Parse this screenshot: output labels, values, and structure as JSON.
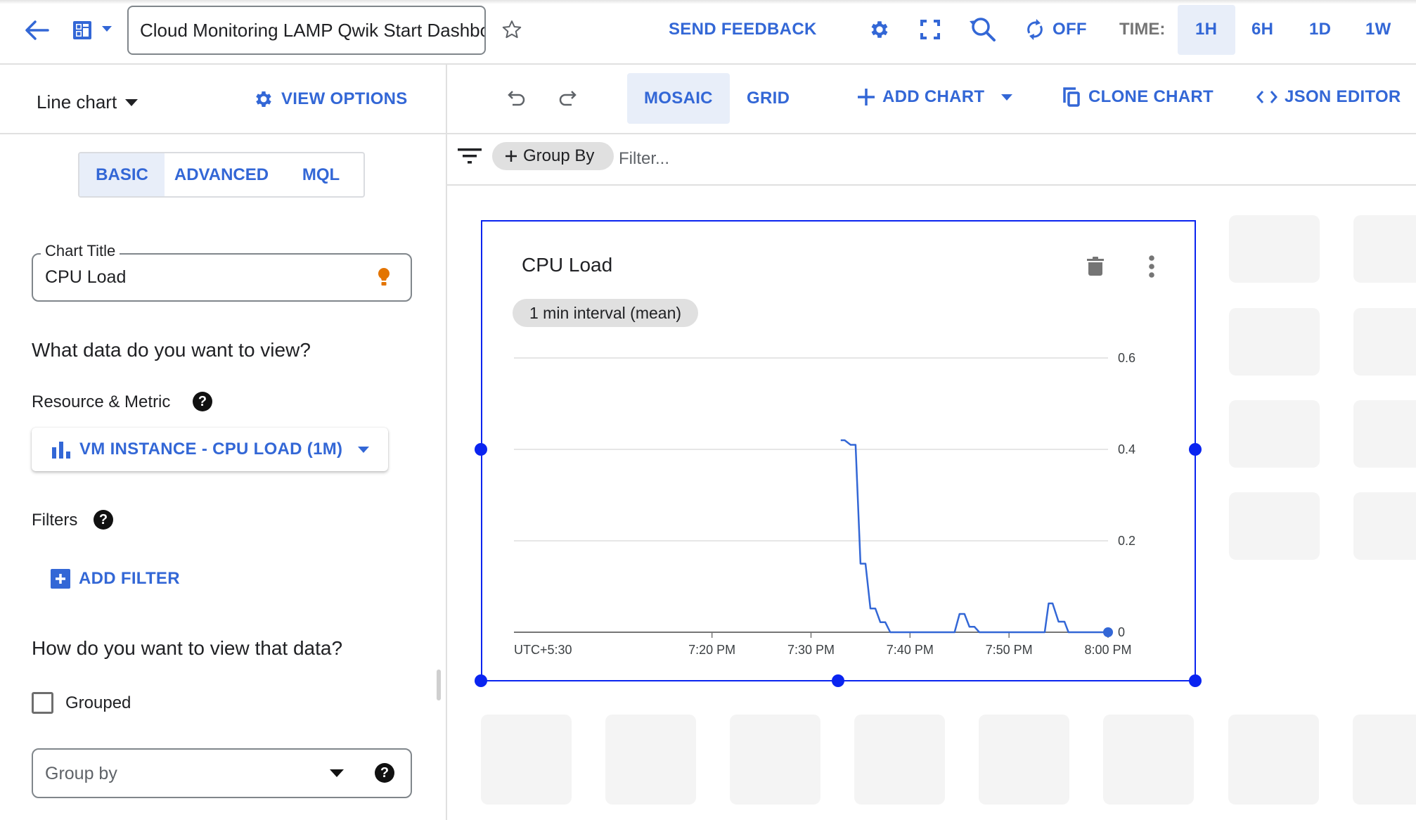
{
  "topbar": {
    "dashboard_title": "Cloud Monitoring LAMP Qwik Start Dashboard",
    "send_feedback": "SEND FEEDBACK",
    "auto_refresh_label": "OFF",
    "time_label": "TIME:",
    "time_ranges": [
      "1H",
      "6H",
      "1D",
      "1W"
    ],
    "selected_time_range": "1H",
    "icons": [
      "back-arrow-icon",
      "dashboard-icon",
      "star-icon",
      "gear-icon",
      "fullscreen-icon",
      "reset-zoom-icon",
      "refresh-icon"
    ]
  },
  "editor": {
    "chart_type": "Line chart",
    "view_options": "VIEW OPTIONS",
    "tabs": [
      "BASIC",
      "ADVANCED",
      "MQL"
    ],
    "selected_tab": "BASIC",
    "chart_title_label": "Chart Title",
    "chart_title_value": "CPU Load",
    "section_data": "What data do you want to view?",
    "resource_metric_label": "Resource & Metric",
    "metric_value": "VM INSTANCE - CPU LOAD (1M)",
    "filters_label": "Filters",
    "add_filter": "ADD FILTER",
    "section_view": "How do you want to view that data?",
    "grouped_label": "Grouped",
    "grouped_checked": false,
    "group_by_placeholder": "Group by"
  },
  "toolbar": {
    "layouts": [
      "MOSAIC",
      "GRID"
    ],
    "selected_layout": "MOSAIC",
    "add_chart": "ADD CHART",
    "clone_chart": "CLONE CHART",
    "json_editor": "JSON EDITOR"
  },
  "filterbar": {
    "group_by_chip": "Group By",
    "filter_placeholder": "Filter..."
  },
  "card": {
    "title": "CPU Load",
    "interval_chip": "1 min interval (mean)"
  },
  "colors": {
    "accent": "#3367d6",
    "series": "#3367d6",
    "selection": "#0a24f0",
    "hint_bulb": "#e37400"
  },
  "chart_data": {
    "type": "line",
    "title": "CPU Load",
    "xlabel": "",
    "ylabel": "",
    "timezone_label": "UTC+5:30",
    "x_ticks": [
      "7:20 PM",
      "7:30 PM",
      "7:40 PM",
      "7:50 PM",
      "8:00 PM"
    ],
    "x_tick_minutes": [
      20,
      30,
      40,
      50,
      60
    ],
    "x_range_minutes": [
      0,
      60
    ],
    "y_ticks": [
      "0",
      "0.2",
      "0.4",
      "0.6"
    ],
    "y_tick_values": [
      0,
      0.2,
      0.4,
      0.6
    ],
    "ylim": [
      0,
      0.6
    ],
    "grid": true,
    "legend": "none",
    "x_unit_note": "minutes after 7:00 PM",
    "series": [
      {
        "name": "CPU load",
        "points": [
          [
            33.0,
            0.42
          ],
          [
            33.4,
            0.42
          ],
          [
            34.0,
            0.41
          ],
          [
            34.5,
            0.41
          ],
          [
            35.0,
            0.15
          ],
          [
            35.5,
            0.15
          ],
          [
            36.0,
            0.052
          ],
          [
            36.5,
            0.052
          ],
          [
            37.0,
            0.022
          ],
          [
            37.5,
            0.022
          ],
          [
            38.0,
            0.0
          ],
          [
            44.5,
            0.0
          ],
          [
            45.0,
            0.04
          ],
          [
            45.5,
            0.04
          ],
          [
            46.0,
            0.012
          ],
          [
            46.5,
            0.012
          ],
          [
            47.0,
            0.0
          ],
          [
            53.6,
            0.0
          ],
          [
            54.0,
            0.063
          ],
          [
            54.4,
            0.063
          ],
          [
            55.0,
            0.023
          ],
          [
            55.6,
            0.023
          ],
          [
            56.0,
            0.0
          ],
          [
            60.0,
            0.0
          ]
        ]
      }
    ]
  }
}
